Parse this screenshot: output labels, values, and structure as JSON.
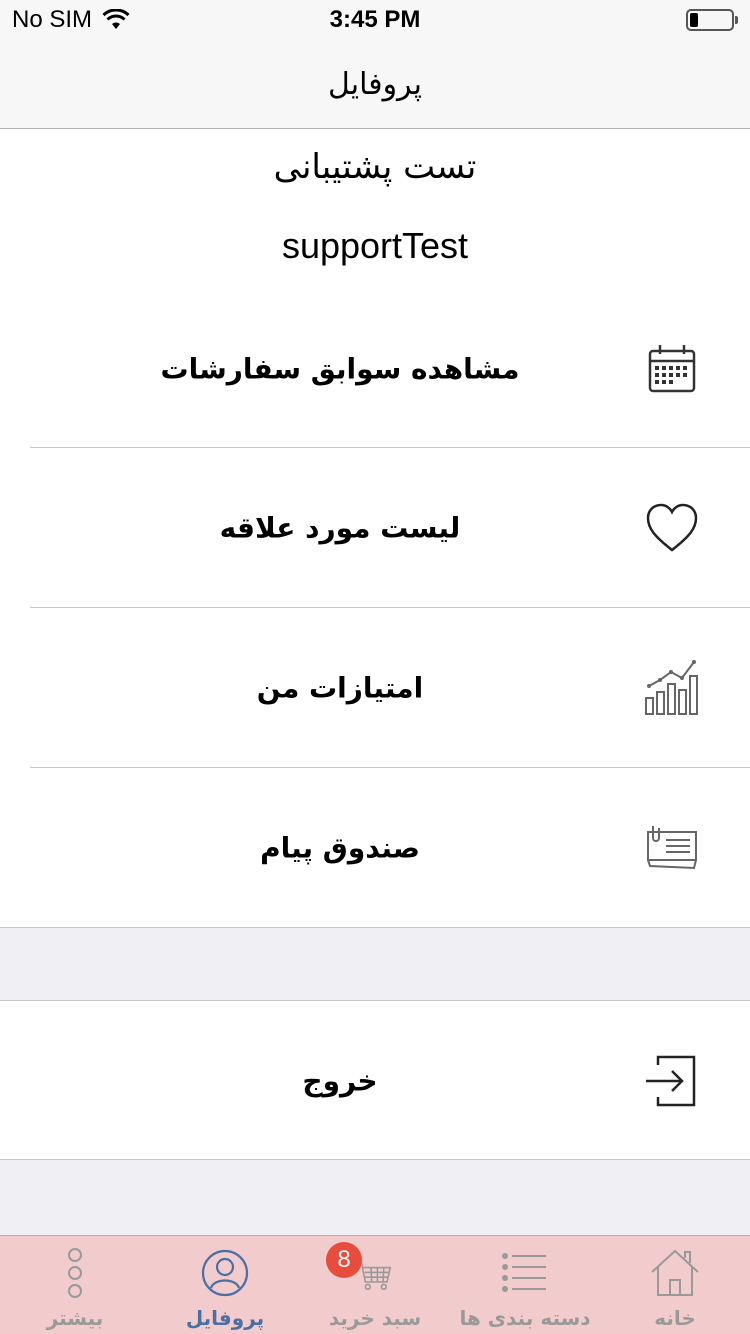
{
  "status_bar": {
    "carrier": "No SIM",
    "time": "3:45 PM",
    "battery_level": 0.2
  },
  "nav": {
    "title": "پروفایل"
  },
  "profile": {
    "name": "تست پشتیبانی",
    "username": "supportTest"
  },
  "menu": {
    "items": [
      {
        "label": "مشاهده سوابق سفارشات",
        "icon": "calendar-icon"
      },
      {
        "label": "لیست مورد علاقه",
        "icon": "heart-icon"
      },
      {
        "label": "امتیازات من",
        "icon": "chart-icon"
      },
      {
        "label": "صندوق پیام",
        "icon": "message-icon"
      }
    ]
  },
  "logout": {
    "label": "خروج",
    "icon": "logout-icon"
  },
  "tabs": [
    {
      "label": "بیشتر",
      "icon": "more-icon",
      "active": false
    },
    {
      "label": "پروفایل",
      "icon": "profile-icon",
      "active": true
    },
    {
      "label": "سبد خرید",
      "icon": "cart-icon",
      "active": false,
      "badge": "8"
    },
    {
      "label": "دسته بندی ها",
      "icon": "list-icon",
      "active": false
    },
    {
      "label": "خانه",
      "icon": "home-icon",
      "active": false
    }
  ],
  "colors": {
    "accent": "#4a6fa5",
    "tab_bar": "#f2cccc",
    "badge": "#e74c3c"
  }
}
